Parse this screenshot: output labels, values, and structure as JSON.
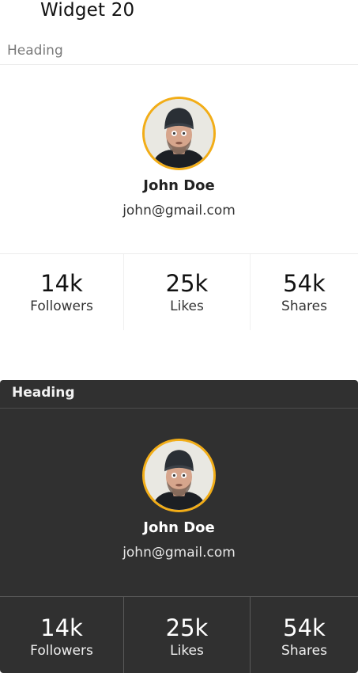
{
  "widget_title": "Widget 20",
  "cards": [
    {
      "theme": "light",
      "heading": "Heading",
      "profile": {
        "name": "John Doe",
        "email": "john@gmail.com"
      },
      "stats": [
        {
          "value": "14k",
          "label": "Followers"
        },
        {
          "value": "25k",
          "label": "Likes"
        },
        {
          "value": "54k",
          "label": "Shares"
        }
      ]
    },
    {
      "theme": "dark",
      "heading": "Heading",
      "profile": {
        "name": "John Doe",
        "email": "john@gmail.com"
      },
      "stats": [
        {
          "value": "14k",
          "label": "Followers"
        },
        {
          "value": "25k",
          "label": "Likes"
        },
        {
          "value": "54k",
          "label": "Shares"
        }
      ]
    }
  ],
  "colors": {
    "avatar_ring": "#f2ad17",
    "dark_card_bg": "#303030",
    "light_card_bg": "#ffffff"
  },
  "icons": {
    "avatar": "avatar-photo-man-beanie"
  }
}
